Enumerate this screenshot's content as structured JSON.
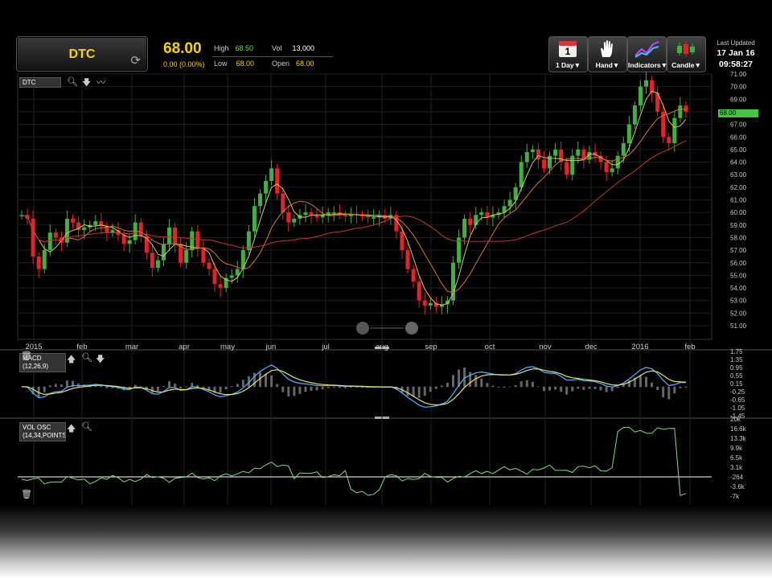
{
  "header": {
    "symbol": "DTC",
    "price": "68.00",
    "change": "0.00 (0.00%)",
    "stats": [
      {
        "label": "High",
        "value": "68.50",
        "color": "#5ee05e"
      },
      {
        "label": "Low",
        "value": "68.00",
        "color": "#f5d400"
      },
      {
        "label": "Vol",
        "value": "13,000",
        "color": "#ffffff"
      },
      {
        "label": "Open",
        "value": "68.00",
        "color": "#f5d400"
      }
    ]
  },
  "toolbar": [
    {
      "label": "1 Day▼",
      "icon": "calendar-icon",
      "calendar_day": "1"
    },
    {
      "label": "Hand▼",
      "icon": "hand-icon"
    },
    {
      "label": "Indicators▼",
      "icon": "indicators-icon"
    },
    {
      "label": "Candle▼",
      "icon": "candle-icon"
    }
  ],
  "last_updated": {
    "label": "Last Updated",
    "date": "17 Jan 16",
    "time": "09:58:27"
  },
  "main_panel": {
    "label": "DTC",
    "current_tag": "68.00",
    "y_ticks": [
      "51.00",
      "52.00",
      "53.00",
      "54.00",
      "55.00",
      "56.00",
      "57.00",
      "58.00",
      "59.00",
      "60.00",
      "61.00",
      "62.00",
      "63.00",
      "64.00",
      "65.00",
      "66.00",
      "67.00",
      "68.00",
      "69.00",
      "70.00",
      "71.00"
    ],
    "x_labels": [
      "2015",
      "feb",
      "mar",
      "apr",
      "may",
      "jun",
      "jul",
      "aug",
      "sep",
      "oct",
      "nov",
      "dec",
      "2016",
      "feb"
    ]
  },
  "macd_panel": {
    "label": "MACD",
    "params": "(12,26,9)",
    "y_ticks": [
      "1.75",
      "1.35",
      "0.95",
      "0.55",
      "0.15",
      "-0.25",
      "-0.65",
      "-1.05",
      "-1.45"
    ]
  },
  "vol_panel": {
    "label": "VOL OSC",
    "params": "(14,34,POINTS",
    "y_ticks": [
      "20k",
      "16.6k",
      "13.3k",
      "9.9k",
      "6.5k",
      "3.1k",
      "-264",
      "-3.6k",
      "-7k"
    ]
  },
  "colors": {
    "up": "#3fb13f",
    "down": "#e8202a",
    "ma_fast": "#d8c850",
    "ma_mid": "#d07a30",
    "ma_slow": "#c0392b",
    "macd": "#4ab8ff",
    "signal": "#e8e070",
    "osc": "#7ae07a"
  },
  "chart_data": {
    "type": "candlestick",
    "symbol": "DTC",
    "x_range": [
      "2015",
      "feb"
    ],
    "ylim": [
      51,
      71
    ],
    "last_close": 68.0,
    "close_series": [
      59.8,
      59.5,
      56.5,
      55.5,
      57.0,
      58.4,
      58.0,
      57.6,
      59.5,
      59.2,
      58.6,
      58.8,
      59.0,
      59.3,
      58.9,
      58.4,
      58.6,
      58.2,
      57.5,
      57.8,
      59.2,
      58.1,
      56.8,
      55.6,
      56.2,
      57.5,
      58.8,
      57.5,
      56.0,
      57.0,
      58.5,
      57.2,
      56.0,
      55.5,
      54.3,
      54.0,
      54.8,
      55.0,
      55.5,
      57.0,
      58.5,
      60.5,
      61.5,
      62.5,
      63.5,
      61.5,
      60.0,
      59.2,
      59.5,
      59.8,
      60.0,
      59.8,
      59.6,
      59.8,
      60.0,
      60.0,
      59.8,
      59.7,
      59.9,
      59.8,
      59.7,
      59.6,
      59.6,
      59.8,
      59.5,
      59.8,
      58.5,
      57.0,
      55.5,
      54.5,
      53.0,
      52.6,
      52.8,
      52.5,
      52.7,
      53.0,
      56.0,
      58.0,
      59.5,
      59.0,
      59.8,
      60.0,
      59.6,
      59.8,
      60.0,
      60.5,
      61.0,
      62.0,
      64.0,
      64.8,
      65.0,
      64.2,
      63.5,
      64.5,
      65.0,
      64.0,
      63.0,
      64.5,
      65.0,
      64.2,
      64.8,
      64.5,
      64.0,
      63.2,
      63.5,
      64.5,
      65.5,
      67.0,
      68.5,
      70.0,
      70.5,
      69.5,
      68.0,
      66.0,
      65.5,
      67.5,
      68.5,
      68.0
    ],
    "macd_y_range": [
      -1.45,
      1.75
    ],
    "vol_osc_y_range": [
      -7000,
      20000
    ]
  }
}
